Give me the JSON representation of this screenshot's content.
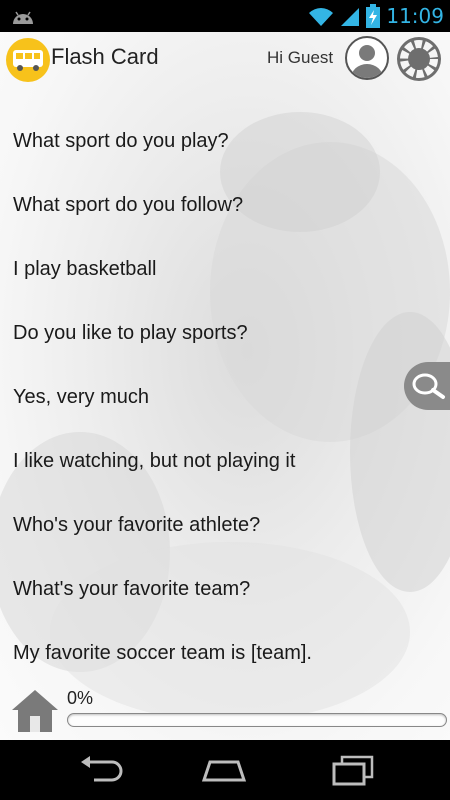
{
  "status_bar": {
    "time": "11:09",
    "icons": [
      "android-icon",
      "wifi-icon",
      "cell-signal-icon",
      "battery-charging-icon"
    ],
    "clock_color": "#33b5e5"
  },
  "header": {
    "logo_icon": "bus-icon",
    "title": "Flash Card",
    "greeting": "Hi Guest",
    "avatar_icon": "user-avatar-icon",
    "settings_icon": "ring-menu-icon",
    "accent_color": "#f7c21b"
  },
  "phrases": [
    "What sport do you play?",
    "What sport do you follow?",
    "I play basketball",
    "Do you like to play sports?",
    "Yes, very much",
    "I like watching, but not playing it",
    "Who's your favorite athlete?",
    "What's your favorite team?",
    "My favorite soccer team is [team]."
  ],
  "search_tab": {
    "icon": "search-icon"
  },
  "footer": {
    "home_icon": "home-icon",
    "progress_label": "0%",
    "progress_fraction": 0
  },
  "nav_bar": {
    "buttons": [
      "back-icon",
      "home-nav-icon",
      "recent-apps-icon"
    ]
  }
}
